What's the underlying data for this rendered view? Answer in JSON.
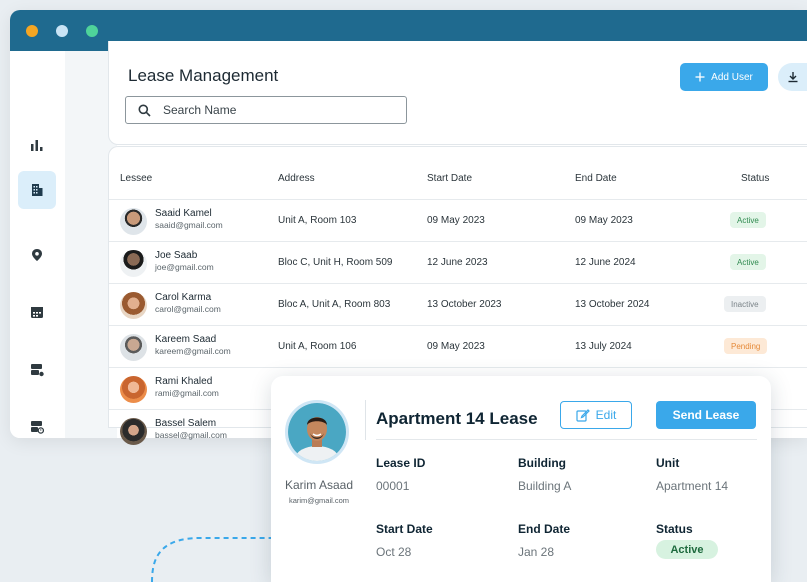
{
  "window": {
    "traffic_lights": [
      "#f5a623",
      "#c9e4f5",
      "#4fd39a"
    ]
  },
  "sidebar": {
    "items": [
      {
        "name": "analytics-icon",
        "active": false
      },
      {
        "name": "building-icon",
        "active": true
      },
      {
        "name": "location-pin-icon",
        "active": false
      },
      {
        "name": "calendar-icon",
        "active": false
      },
      {
        "name": "server-icon",
        "active": false
      },
      {
        "name": "server-clock-icon",
        "active": false
      }
    ]
  },
  "header": {
    "title": "Lease Management",
    "search_placeholder": "Search Name",
    "add_user_label": "Add User"
  },
  "table": {
    "columns": [
      "Lessee",
      "Address",
      "Start Date",
      "End Date",
      "Status"
    ],
    "rows": [
      {
        "name": "Saaid Kamel",
        "email": "saaid@gmail.com",
        "address": "Unit A, Room 103",
        "start": "09 May 2023",
        "end": "09 May 2023",
        "status": "Active"
      },
      {
        "name": "Joe Saab",
        "email": "joe@gmail.com",
        "address": "Bloc C, Unit H, Room 509",
        "start": "12 June 2023",
        "end": "12 June 2024",
        "status": "Active"
      },
      {
        "name": "Carol Karma",
        "email": "carol@gmail.com",
        "address": "Bloc A, Unit A, Room 803",
        "start": "13 October 2023",
        "end": "13 October 2024",
        "status": "Inactive"
      },
      {
        "name": "Kareem Saad",
        "email": "kareem@gmail.com",
        "address": "Unit A, Room 106",
        "start": "09 May 2023",
        "end": "13 July 2024",
        "status": "Pending"
      },
      {
        "name": "Rami Khaled",
        "email": "rami@gmail.com",
        "address": "",
        "start": "",
        "end": "",
        "status": ""
      },
      {
        "name": "Bassel Salem",
        "email": "bassel@gmail.com",
        "address": "",
        "start": "",
        "end": "",
        "status": ""
      }
    ]
  },
  "modal": {
    "title": "Apartment 14 Lease",
    "edit_label": "Edit",
    "send_label": "Send Lease",
    "person_name": "Karim Asaad",
    "person_email": "karim@gmail.com",
    "fields": {
      "lease_id_label": "Lease ID",
      "lease_id": "00001",
      "building_label": "Building",
      "building": "Building A",
      "unit_label": "Unit",
      "unit": "Apartment 14",
      "start_label": "Start Date",
      "start": "Oct 28",
      "end_label": "End Date",
      "end": "Jan 28",
      "status_label": "Status",
      "status": "Active"
    }
  },
  "colors": {
    "accent": "#3aa8ea",
    "titlebar": "#1f6a8f",
    "active_bg": "#e3f5e8",
    "active_fg": "#2f8a4f",
    "inactive_bg": "#eceff1",
    "inactive_fg": "#7a8388",
    "pending_bg": "#fde9d6",
    "pending_fg": "#e58a3a"
  }
}
